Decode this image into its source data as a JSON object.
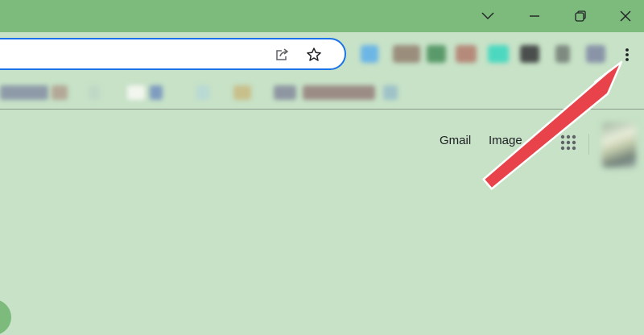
{
  "window": {
    "buttons": [
      {
        "name": "tab-search-button",
        "icon": "chevron-down-icon"
      },
      {
        "name": "minimize-button",
        "icon": "minimize-icon"
      },
      {
        "name": "restore-button",
        "icon": "restore-icon"
      },
      {
        "name": "close-button",
        "icon": "close-icon"
      }
    ]
  },
  "omnibox": {
    "value": "",
    "placeholder": "",
    "icons": [
      "share-icon",
      "star-icon"
    ]
  },
  "toolbar": {
    "menu_icon": "three-dots-vertical-icon"
  },
  "page": {
    "links": {
      "gmail": "Gmail",
      "images": "Image"
    },
    "apps_icon": "apps-grid-icon"
  },
  "annotation": {
    "arrow_color": "#e8424a"
  },
  "colors": {
    "titlebar": "#7dbb7d",
    "background": "#c7e2c7",
    "omnibox_border": "#1a73e8"
  }
}
